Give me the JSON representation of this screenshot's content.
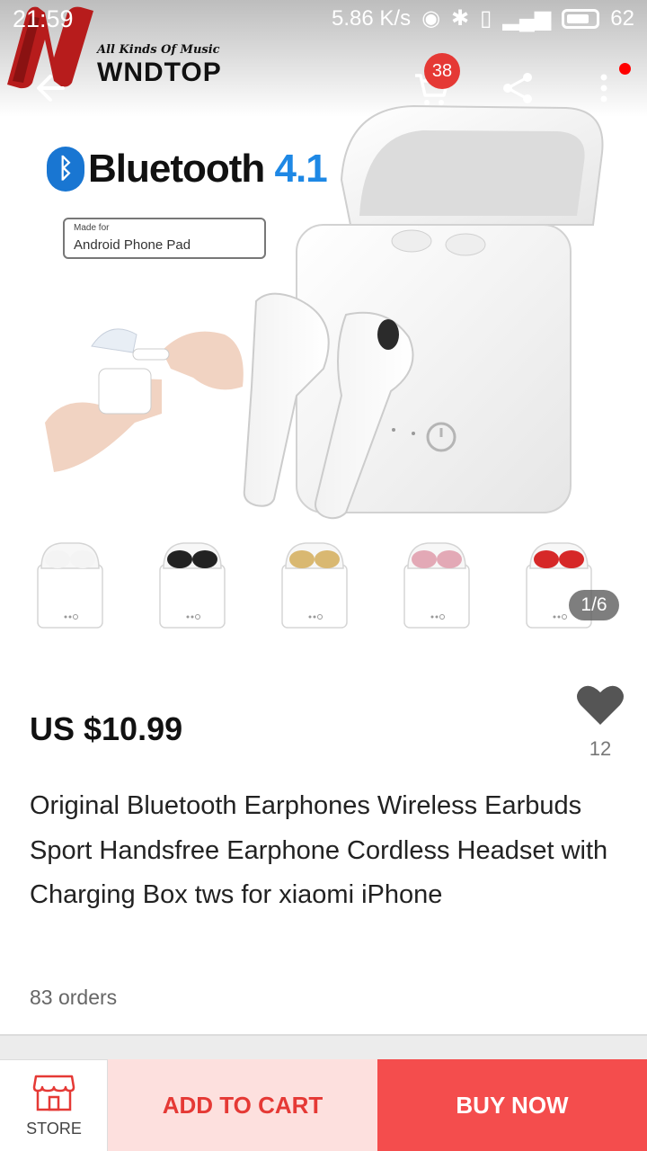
{
  "status_bar": {
    "time": "21:59",
    "net_speed": "5.86 K/s",
    "battery": "62"
  },
  "watermark": {
    "tagline": "All Kinds Of Music",
    "brand": "WNDTOP"
  },
  "header": {
    "cart_count": "38",
    "icons": [
      "back-arrow-icon",
      "cart-icon",
      "share-icon",
      "more-icon"
    ]
  },
  "gallery": {
    "badge_title": "Bluetooth",
    "badge_version": "4.1",
    "made_for_title": "Made for",
    "made_for_items": "Android  Phone  Pad",
    "page_indicator": "1/6",
    "thumbnail_colors": [
      "#f4f4f4",
      "#222222",
      "#d9b871",
      "#e3a9b6",
      "#d62828"
    ]
  },
  "product": {
    "price": "US $10.99",
    "wish_count": "12",
    "title": "Original Bluetooth Earphones Wireless Earbuds Sport Handsfree Earphone Cordless Headset with Charging Box tws for xiaomi iPhone",
    "orders": "83 orders"
  },
  "bottom_bar": {
    "store_label": "STORE",
    "add_to_cart_label": "ADD TO CART",
    "buy_now_label": "BUY NOW"
  },
  "colors": {
    "accent_red": "#f44d4d",
    "add_cart_bg": "#fde0de",
    "add_cart_text": "#e53935",
    "bluetooth_blue": "#1e88e5"
  }
}
